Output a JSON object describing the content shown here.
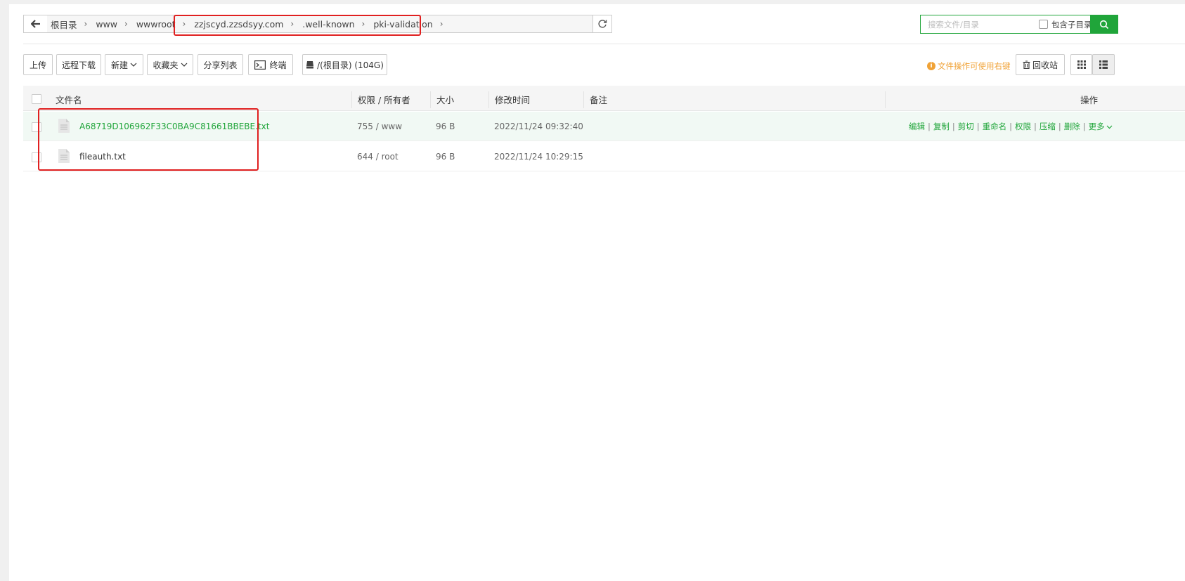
{
  "breadcrumbs": [
    "根目录",
    "www",
    "wwwroot",
    "zzjscyd.zzsdsyy.com",
    ".well-known",
    "pki-validation"
  ],
  "search": {
    "placeholder": "搜索文件/目录",
    "include_subdir": "包含子目录"
  },
  "toolbar": {
    "upload": "上传",
    "remote_download": "远程下载",
    "new": "新建",
    "favorites": "收藏夹",
    "share_list": "分享列表",
    "terminal": "终端",
    "disk": "/(根目录) (104G)",
    "tip": "文件操作可使用右键",
    "recycle": "回收站"
  },
  "table": {
    "headers": {
      "name": "文件名",
      "perm": "权限 / 所有者",
      "size": "大小",
      "mtime": "修改时间",
      "note": "备注",
      "ops": "操作"
    },
    "rows": [
      {
        "name": "A68719D106962F33C0BA9C81661BBEBE.txt",
        "perm": "755 / www",
        "size": "96 B",
        "mtime": "2022/11/24 09:32:40"
      },
      {
        "name": "fileauth.txt",
        "perm": "644 / root",
        "size": "96 B",
        "mtime": "2022/11/24 10:29:15"
      }
    ],
    "actions": [
      "编辑",
      "复制",
      "剪切",
      "重命名",
      "权限",
      "压缩",
      "删除",
      "更多"
    ]
  },
  "colors": {
    "accent": "#20a53a",
    "annotation": "#e02020",
    "tip": "#f0a236"
  }
}
